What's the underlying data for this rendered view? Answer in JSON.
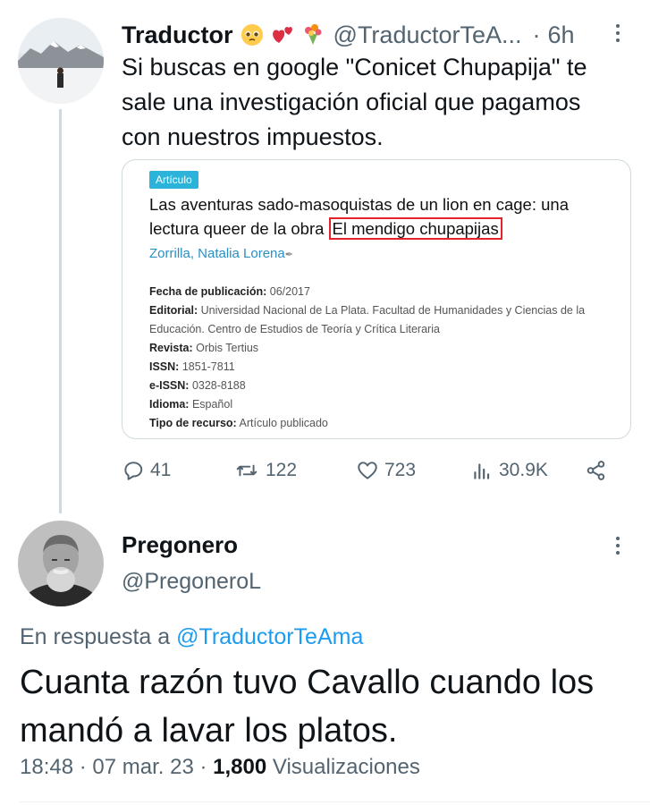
{
  "tweet1": {
    "name": "Traductor",
    "handle": "@TraductorTeA...",
    "dot": "·",
    "time": "6h",
    "text": "Si buscas en google \"Conicet Chupapija\" te sale una investigación oficial que pagamos con nuestros impuestos.",
    "emojis": [
      "pleading-face-emoji",
      "two-hearts-emoji",
      "bouquet-emoji"
    ],
    "card": {
      "badge": "Artículo",
      "title_part1": "Las aventuras sado-masoquistas de un lion en cage: una lectura queer de la obra",
      "title_highlight": "El mendigo chupapijas",
      "author": "Zorrilla, Natalia Lorena",
      "fields": [
        {
          "label": "Fecha de publicación:",
          "value": "06/2017"
        },
        {
          "label": "Editorial:",
          "value": "Universidad Nacional de La Plata. Facultad de Humanidades y Ciencias de la Educación. Centro de Estudios de Teoría y Crítica Literaria"
        },
        {
          "label": "Revista:",
          "value": "Orbis Tertius"
        },
        {
          "label": "ISSN:",
          "value": "1851-7811"
        },
        {
          "label": "e-ISSN:",
          "value": "0328-8188"
        },
        {
          "label": "Idioma:",
          "value": "Español"
        },
        {
          "label": "Tipo de recurso:",
          "value": "Artículo publicado"
        }
      ]
    },
    "actions": {
      "replies": "41",
      "retweets": "122",
      "likes": "723",
      "views": "30.9K"
    }
  },
  "tweet2": {
    "name": "Pregonero",
    "handle": "@PregoneroL",
    "reply_prefix": "En respuesta a",
    "reply_to": "@TraductorTeAma",
    "text": "Cuanta razón tuvo Cavallo cuando los mandó a lavar los platos.",
    "time": "18:48",
    "date": "07 mar. 23",
    "views_count": "1,800",
    "views_label": "Visualizaciones"
  },
  "colors": {
    "text": "#0f1419",
    "secondary": "#536471",
    "link": "#1d9bf0",
    "border": "#cfd9de",
    "badge": "#2bb3d9",
    "highlight_box": "#e2242a"
  }
}
